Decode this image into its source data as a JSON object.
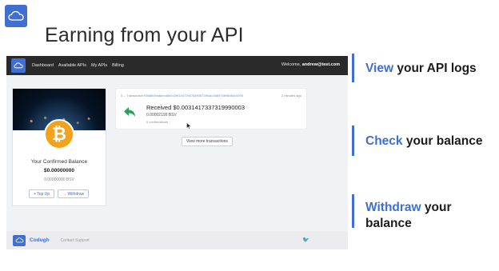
{
  "slide": {
    "title": "Earning from your API",
    "logo_icon": "cloud-icon"
  },
  "app": {
    "nav": {
      "links": [
        "Dashboard",
        "Available APIs",
        "My APIs",
        "Billing"
      ],
      "welcome_prefix": "Welcome,",
      "user_email": "andrew@test.com"
    },
    "balance_card": {
      "label": "Your Confirmed Balance",
      "value": "$0.00000000",
      "bsv": "0.00000000 BSV",
      "coin_symbol": "₿",
      "top_up": "+ Top Up",
      "withdraw": "→ Withdraw"
    },
    "transaction": {
      "prefix": "0←",
      "label": "Transaction",
      "hash": "f0fa8b0bea6ecd8e2d39f1d47296784ff3673f94ac3d6974fe5fd6dc0095",
      "time": "2 minutes ago",
      "received": "Received $0.0031417337319990003",
      "amount_bsv": "0.00002199 BSV",
      "confirmations": "0 confirmations"
    },
    "more_button": "View more transactions",
    "footer": {
      "brand": "Codugh",
      "support": "Contact Support",
      "social_icon": "twitter-icon",
      "social_glyph": "🐦"
    }
  },
  "features": [
    {
      "highlight": "View",
      "rest": " your API logs"
    },
    {
      "highlight": "Check",
      "rest": " your balance"
    },
    {
      "highlight": "Withdraw",
      "rest": " your balance"
    }
  ],
  "colors": {
    "accent": "#3f6fd1",
    "navbar": "#2a2a2a",
    "coin": "#f2a31b",
    "receive_arrow": "#27a05a"
  }
}
